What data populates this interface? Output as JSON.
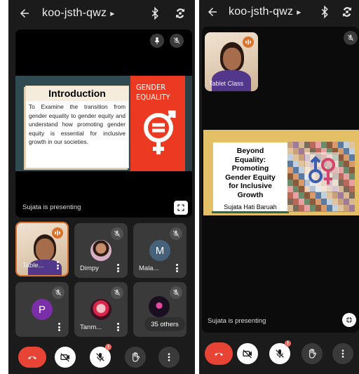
{
  "left": {
    "meeting_code": "koo-jsth-qwz",
    "slide": {
      "heading": "Introduction",
      "body": "To Examine the transition from gender equality to gender equity and understand how promoting gender equity is essential for inclusive growth in our societies.",
      "badge_line1": "GENDER",
      "badge_line2": "EQUALITY"
    },
    "presenting_label": "Sujata is presenting",
    "participants": [
      {
        "name": "Table...",
        "kind": "video",
        "speaking": true
      },
      {
        "name": "Dimpy",
        "kind": "photo"
      },
      {
        "name": "Mala...",
        "kind": "initial",
        "initial": "M",
        "color": "#45627a"
      },
      {
        "name": "",
        "kind": "initial",
        "initial": "P",
        "color": "#7a2fa8"
      },
      {
        "name": "Tanm...",
        "kind": "photo"
      },
      {
        "name": "",
        "kind": "photo",
        "overflow_label": "35 others"
      }
    ]
  },
  "right": {
    "meeting_code": "koo-jsth-qwz",
    "self_tile_name": "Tablet Class",
    "slide": {
      "title_lines": [
        "Beyond",
        "Equality:",
        "Promoting",
        "Gender Equity",
        "for Inclusive",
        "Growth"
      ],
      "author": "Sujata Hati Baruah"
    },
    "presenting_label": "Sujata is presenting"
  },
  "controls": {
    "raise_hand_badge": "!"
  },
  "colors": {
    "end_call": "#e84436",
    "speaking": "#d8722d",
    "sdg_red": "#ec3a22",
    "slide_yellow": "#e3bf66"
  },
  "icons": [
    "back-arrow-icon",
    "bluetooth-icon",
    "switch-camera-icon",
    "pin-icon",
    "mic-off-icon",
    "fullscreen-icon",
    "end-call-icon",
    "camera-off-icon",
    "hand-icon",
    "more-icon",
    "audio-wave-icon",
    "collapse-icon"
  ]
}
